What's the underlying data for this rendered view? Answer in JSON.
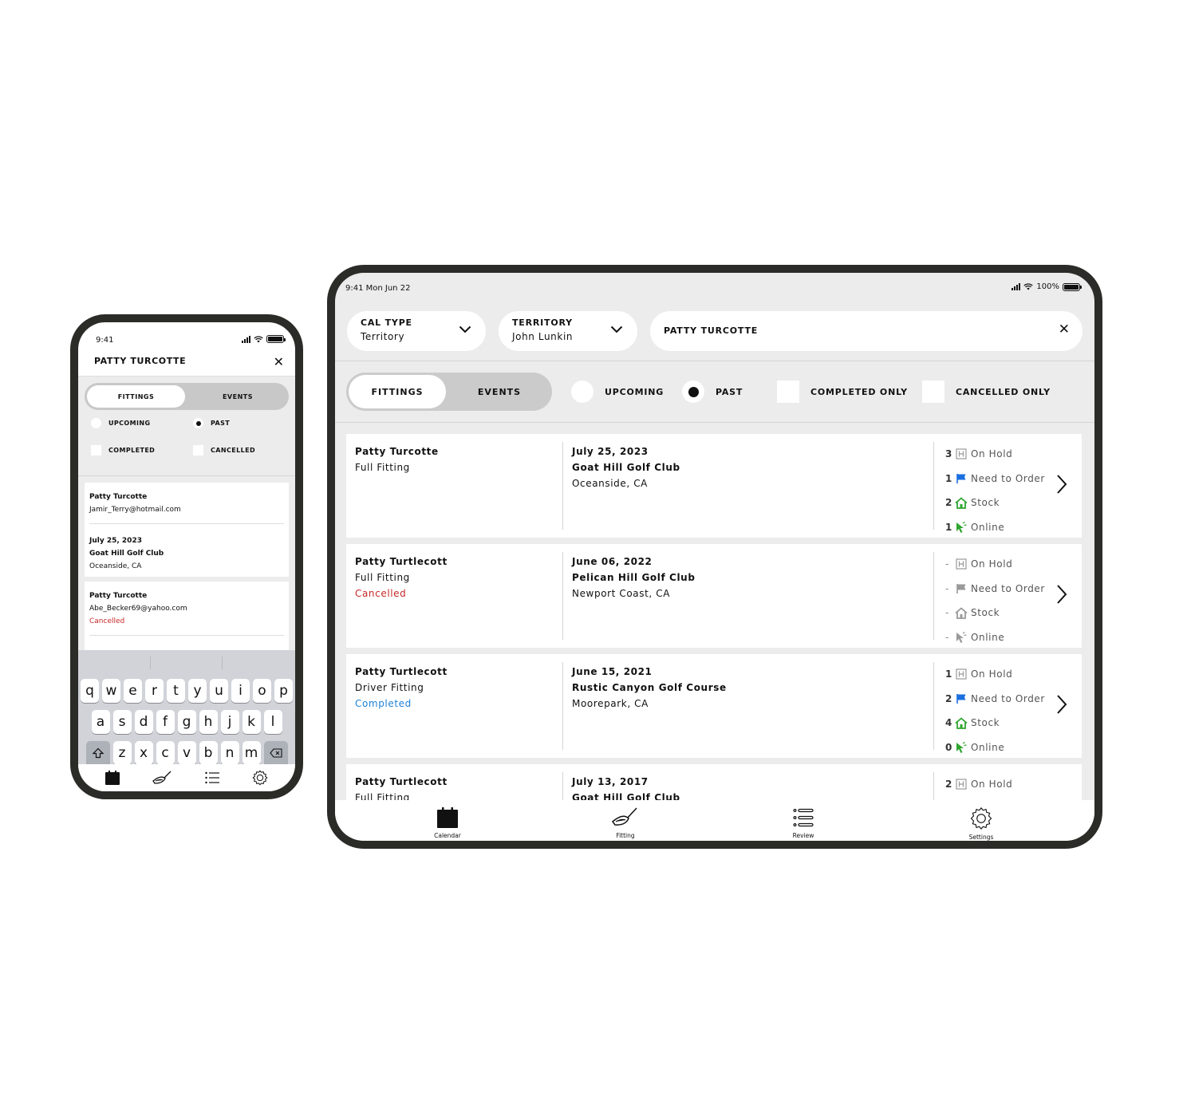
{
  "phone": {
    "status": {
      "time": "9:41"
    },
    "header": {
      "title": "PATTY TURCOTTE"
    },
    "segment": {
      "fittings": "FITTINGS",
      "events": "EVENTS"
    },
    "filters": {
      "upcoming": "UPCOMING",
      "past": "PAST",
      "completed": "COMPLETED",
      "cancelled": "CANCELLED"
    },
    "cards": [
      {
        "name": "Patty Turcotte",
        "email": "Jamir_Terry@hotmail.com",
        "date": "July 25, 2023",
        "venue": "Goat Hill Golf Club",
        "location": "Oceanside, CA"
      },
      {
        "name": "Patty Turcotte",
        "email": "Abe_Becker69@yahoo.com",
        "status": "Cancelled"
      }
    ],
    "keyboard": {
      "row1": [
        "q",
        "w",
        "e",
        "r",
        "t",
        "y",
        "u",
        "i",
        "o",
        "p"
      ],
      "row2": [
        "a",
        "s",
        "d",
        "f",
        "g",
        "h",
        "j",
        "k",
        "l"
      ],
      "row3": [
        "z",
        "x",
        "c",
        "v",
        "b",
        "n",
        "m"
      ]
    }
  },
  "tablet": {
    "status": {
      "time": "9:41  Mon Jun 22",
      "battery": "100%"
    },
    "cal_type": {
      "label": "CAL TYPE",
      "value": "Territory"
    },
    "territory": {
      "label": "TERRITORY",
      "value": "John Lunkin"
    },
    "search": {
      "value": "PATTY TURCOTTE"
    },
    "segment": {
      "fittings": "FITTINGS",
      "events": "EVENTS"
    },
    "filters": {
      "upcoming": "UPCOMING",
      "past": "PAST",
      "completed_only": "COMPLETED ONLY",
      "cancelled_only": "CANCELLED ONLY"
    },
    "inventory_labels": {
      "on_hold": "On Hold",
      "need_to_order": "Need to Order",
      "stock": "Stock",
      "online": "Online"
    },
    "cards": [
      {
        "name": "Patty Turcotte",
        "fitting": "Full Fitting",
        "status": "",
        "date": "July 25, 2023",
        "venue": "Goat Hill Golf Club",
        "location": "Oceanside, CA",
        "on_hold": "3",
        "need_to_order": "1",
        "stock": "2",
        "online": "1"
      },
      {
        "name": "Patty Turtlecott",
        "fitting": "Full Fitting",
        "status": "Cancelled",
        "date": "June 06, 2022",
        "venue": "Pelican Hill Golf Club",
        "location": "Newport Coast, CA",
        "on_hold": "-",
        "need_to_order": "-",
        "stock": "-",
        "online": "-"
      },
      {
        "name": "Patty Turtlecott",
        "fitting": "Driver Fitting",
        "status": "Completed",
        "date": "June 15, 2021",
        "venue": "Rustic Canyon Golf Course",
        "location": "Moorepark, CA",
        "on_hold": "1",
        "need_to_order": "2",
        "stock": "4",
        "online": "0"
      },
      {
        "name": "Patty Turtlecott",
        "fitting": "Full Fitting",
        "date": "July 13, 2017",
        "venue": "Goat Hill Golf Club",
        "on_hold": "2"
      }
    ],
    "tabs": {
      "calendar": "Calendar",
      "fitting": "Fitting",
      "review": "Review",
      "settings": "Settings"
    }
  },
  "colors": {
    "flag_blue": "#1a6fe0",
    "stock_green": "#2fa52f",
    "cancelled_red": "#c62828",
    "completed_blue": "#1e82d8",
    "frame": "#2b2b27"
  }
}
